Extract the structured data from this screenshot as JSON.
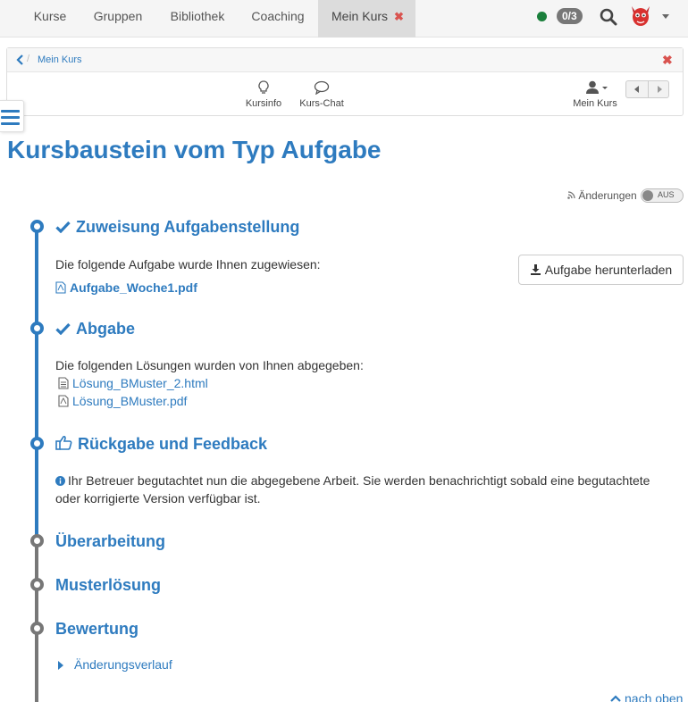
{
  "topnav": {
    "tabs": [
      {
        "label": "Kurse"
      },
      {
        "label": "Gruppen"
      },
      {
        "label": "Bibliothek"
      },
      {
        "label": "Coaching"
      },
      {
        "label": "Mein Kurs"
      }
    ],
    "badge": "0/3",
    "status_color": "#1a7f3b"
  },
  "breadcrumb": {
    "current": "Mein Kurs"
  },
  "toolbar": {
    "kursinfo": "Kursinfo",
    "kurschat": "Kurs-Chat",
    "mein_kurs": "Mein Kurs"
  },
  "page": {
    "title": "Kursbaustein vom Typ Aufgabe",
    "changes_label": "Änderungen",
    "toggle_label": "AUS"
  },
  "steps": {
    "assignment": {
      "title": "Zuweisung Aufgabenstellung",
      "text": "Die folgende Aufgabe wurde Ihnen zugewiesen:",
      "file": "Aufgabe_Woche1.pdf",
      "download_label": "Aufgabe herunterladen"
    },
    "submission": {
      "title": "Abgabe",
      "text": "Die folgenden Lösungen wurden von Ihnen abgegeben:",
      "files": [
        "Lösung_BMuster_2.html",
        "Lösung_BMuster.pdf"
      ]
    },
    "feedback": {
      "title": "Rückgabe und Feedback",
      "line1": "Ihr Betreuer begutachtet nun die abgegebene Arbeit. Sie werden benachrichtigt sobald eine begutachtete",
      "line2": "oder korrigierte Version verfügbar ist."
    },
    "revision": {
      "title": "Überarbeitung"
    },
    "solution": {
      "title": "Musterlösung"
    },
    "grading": {
      "title": "Bewertung",
      "history": "Änderungsverlauf"
    }
  },
  "footer": {
    "back_to_top": "nach oben"
  },
  "colors": {
    "accent": "#2e7bbf",
    "danger": "#d9534f",
    "grey_timeline": "#777777"
  }
}
